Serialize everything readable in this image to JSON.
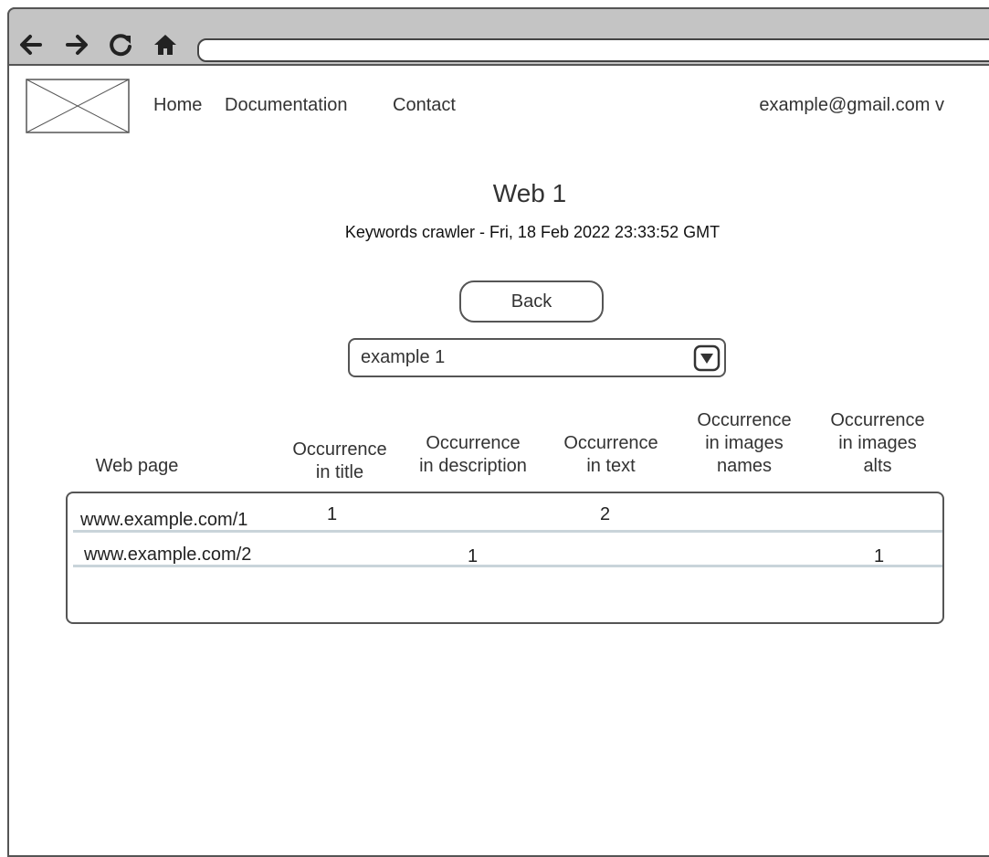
{
  "browser": {
    "back_icon": "arrow-left-icon",
    "forward_icon": "arrow-right-icon",
    "reload_icon": "reload-icon",
    "home_icon": "home-icon",
    "address": ""
  },
  "header": {
    "logo_icon": "image-placeholder-icon",
    "nav": [
      {
        "label": "Home"
      },
      {
        "label": "Documentation"
      },
      {
        "label": "Contact"
      }
    ],
    "account": "example@gmail.com v"
  },
  "main": {
    "title": "Web 1",
    "subtitle": "Keywords crawler - Fri, 18 Feb 2022 23:33:52 GMT",
    "back_label": "Back",
    "select": {
      "value": "example 1",
      "arrow_icon": "dropdown-arrow-icon"
    }
  },
  "table": {
    "headers": [
      "Web page",
      "Occurrence\nin title",
      "Occurrence\nin description",
      "Occurrence\nin text",
      "Occurrence\nin images\nnames",
      "Occurrence\nin images\nalts"
    ],
    "rows": [
      {
        "page": "www.example.com/1",
        "title": "1",
        "description": "",
        "text": "2",
        "images_names": "",
        "images_alts": ""
      },
      {
        "page": "www.example.com/2",
        "title": "",
        "description": "1",
        "text": "",
        "images_names": "",
        "images_alts": "1"
      }
    ]
  },
  "colors": {
    "toolbar": "#c4c4c4",
    "border": "#555555",
    "row_divider": "#c9d4da"
  }
}
